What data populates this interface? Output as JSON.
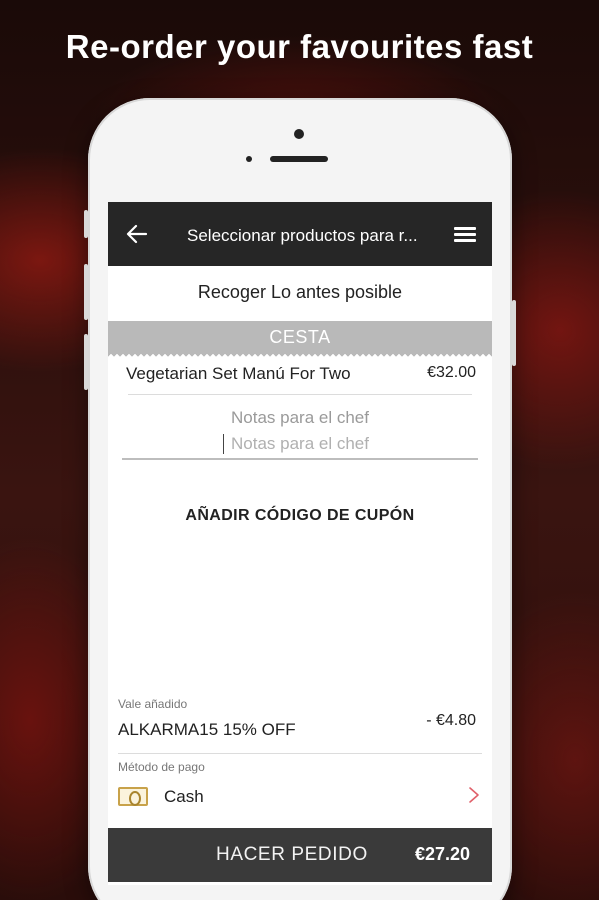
{
  "promo": {
    "headline": "Re-order your favourites fast"
  },
  "appbar": {
    "back_icon": "arrow-left-icon",
    "title": "Seleccionar productos para r...",
    "menu_icon": "hamburger-menu-icon"
  },
  "pickup": {
    "label": "Recoger Lo antes posible"
  },
  "basket": {
    "section_label": "CESTA",
    "items": [
      {
        "name": "Vegetarian Set Manú For Two",
        "price": "€32.00"
      }
    ]
  },
  "chef_notes": {
    "label": "Notas para el chef",
    "placeholder": "Notas para el chef"
  },
  "coupon": {
    "link_label": "AÑADIR CÓDIGO DE CUPÓN"
  },
  "voucher": {
    "caption": "Vale añadido",
    "code": "ALKARMA15 15% OFF",
    "amount": "- €4.80"
  },
  "payment": {
    "caption": "Método de pago",
    "method": "Cash",
    "method_icon": "cash-icon"
  },
  "order": {
    "button_label": "HACER PEDIDO",
    "total": "€27.20"
  },
  "colors": {
    "appbar": "#262626",
    "basket_band": "#b9b9b9",
    "order_bar": "#3a3a3a",
    "chevron": "#e0606a"
  }
}
